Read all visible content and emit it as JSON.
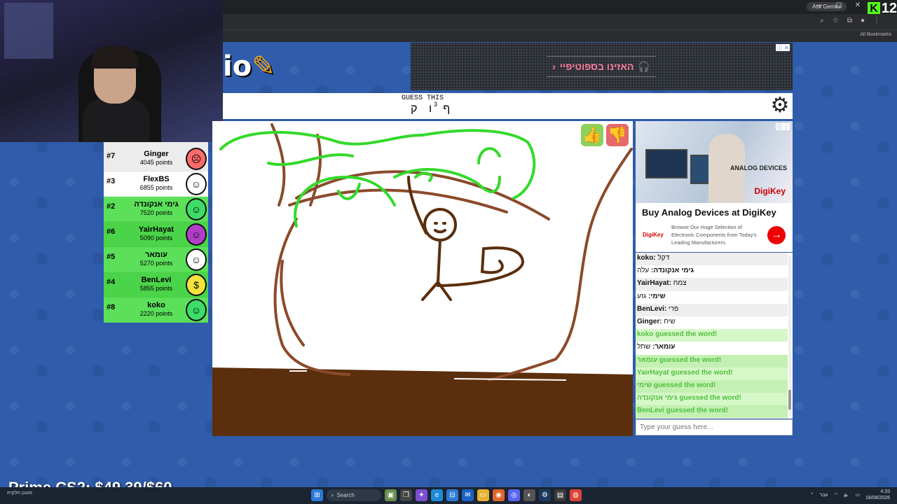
{
  "browser": {
    "gemini_label": "Ask Gemini",
    "kick_logo": "K",
    "kick_count": "12",
    "all_bookmarks": "All Bookmarks",
    "win_minimize": "—",
    "win_maximize": "▢",
    "win_close": "✕"
  },
  "game": {
    "logo_text": "io",
    "logo_pencil": "✎",
    "guess_label": "GUESS THIS",
    "word_hint": "ף ו ק",
    "word_count": "3",
    "settings_icon": "gear-icon",
    "canvas_bg": "#ffffff",
    "ground_color": "#5b2e0d",
    "tree_color": "#8b4a2b",
    "leaves_color": "#34d92b",
    "figure_color": "#5b2e0d"
  },
  "ad_top": {
    "text": "האזינו בספוטיפיי",
    "arrow": "‹",
    "headphone": "🎧",
    "info": "ⓘ",
    "close": "✕"
  },
  "players": [
    {
      "rank": "#7",
      "name": "Ginger",
      "points": "4045 points",
      "state": "a",
      "avatar_color": "#ff6b6b",
      "avatar": "☹"
    },
    {
      "rank": "#3",
      "name": "FlexBS",
      "points": "6855 points",
      "state": "b",
      "avatar_color": "#ffffff",
      "avatar": "☺"
    },
    {
      "rank": "#2",
      "name": "גימי אנקונדה",
      "points": "7520 points",
      "state": "g",
      "avatar_color": "#3ddc6a",
      "avatar": "☺"
    },
    {
      "rank": "#6",
      "name": "YairHayat",
      "points": "5090 points",
      "state": "g2",
      "avatar_color": "#b23ec8",
      "avatar": "☺"
    },
    {
      "rank": "#5",
      "name": "עומאר",
      "points": "5270 points",
      "state": "g",
      "avatar_color": "#ffffff",
      "avatar": "☺"
    },
    {
      "rank": "#4",
      "name": "BenLevi",
      "points": "5855 points",
      "state": "g2",
      "avatar_color": "#f3e23b",
      "avatar": "$"
    },
    {
      "rank": "#8",
      "name": "koko",
      "points": "2220 points",
      "state": "g",
      "avatar_color": "#3ddc6a",
      "avatar": "☺"
    }
  ],
  "ad_right": {
    "brand": "ANALOG DEVICES",
    "digikey": "DigiKey",
    "title": "Buy Analog Devices at DigiKey",
    "small_logo": "DigiKey",
    "desc": "Browse Our Huge Selection of Electronic Components from Today's Leading Manufacturers.",
    "arrow": "→",
    "info": "ⓘ",
    "close": "⋮"
  },
  "chat": [
    {
      "author": "koko:",
      "text": " דקל",
      "type": "shade"
    },
    {
      "author": "גימי אנקונדה:",
      "text": " עלה",
      "type": "plain"
    },
    {
      "author": "YairHayat:",
      "text": " צמח",
      "type": "shade"
    },
    {
      "author": "שימי:",
      "text": " גזע",
      "type": "plain"
    },
    {
      "author": "BenLevi:",
      "text": " פרי",
      "type": "shade"
    },
    {
      "author": "Ginger:",
      "text": " שיח",
      "type": "plain"
    },
    {
      "author": "",
      "text": "koko guessed the word!",
      "type": "guessed"
    },
    {
      "author": "עומאר:",
      "text": " שתל",
      "type": "plain"
    },
    {
      "author": "",
      "text": "עומאר guessed the word!",
      "type": "guessed alt"
    },
    {
      "author": "",
      "text": "YairHayat guessed the word!",
      "type": "guessed"
    },
    {
      "author": "",
      "text": "שימי guessed the word!",
      "type": "guessed alt"
    },
    {
      "author": "",
      "text": "גימי אנקונדה guessed the word!",
      "type": "guessed"
    },
    {
      "author": "",
      "text": "BenLevi guessed the word!",
      "type": "guessed alt"
    }
  ],
  "chat_input": {
    "placeholder": "Type your guess here..."
  },
  "taskbar": {
    "search_label": "Search",
    "weather": "מעונן חלקית",
    "time": "4:33",
    "date": "18/08/2026",
    "lang": "עבר"
  },
  "overlay": {
    "text": "Prime CS2: $49.39/$60"
  }
}
